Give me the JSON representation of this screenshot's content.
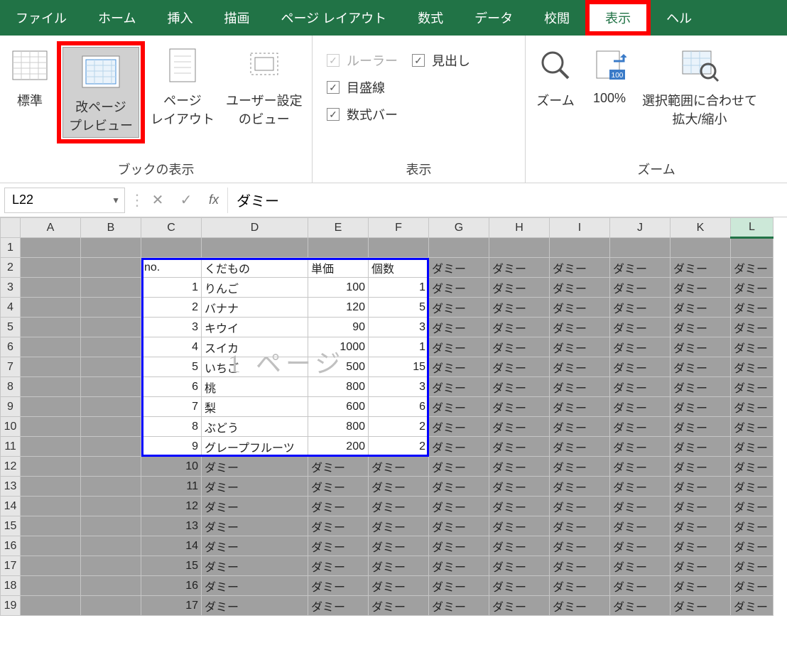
{
  "menu": {
    "tabs": [
      "ファイル",
      "ホーム",
      "挿入",
      "描画",
      "ページ レイアウト",
      "数式",
      "データ",
      "校閲",
      "表示",
      "ヘル"
    ],
    "active": "表示"
  },
  "ribbon": {
    "group_views": {
      "label": "ブックの表示",
      "normal": "標準",
      "page_break": "改ページ\nプレビュー",
      "page_layout": "ページ\nレイアウト",
      "custom": "ユーザー設定\nのビュー"
    },
    "group_show": {
      "label": "表示",
      "ruler": "ルーラー",
      "headings": "見出し",
      "gridlines": "目盛線",
      "formula_bar": "数式バー"
    },
    "group_zoom": {
      "label": "ズーム",
      "zoom": "ズーム",
      "hundred": "100%",
      "fit": "選択範囲に合わせて\n拡大/縮小"
    }
  },
  "formula_bar": {
    "name_box": "L22",
    "fx": "fx",
    "formula": "ダミー"
  },
  "grid": {
    "columns": [
      "A",
      "B",
      "C",
      "D",
      "E",
      "F",
      "G",
      "H",
      "I",
      "J",
      "K",
      "L"
    ],
    "active_col": "L",
    "rows": [
      1,
      2,
      3,
      4,
      5,
      6,
      7,
      8,
      9,
      10,
      11,
      12,
      13,
      14,
      15,
      16,
      17,
      18,
      19
    ],
    "header": {
      "no": "no.",
      "name": "くだもの",
      "price": "単価",
      "qty": "個数"
    },
    "fruits": [
      {
        "no": 1,
        "name": "りんご",
        "price": 100,
        "qty": 1
      },
      {
        "no": 2,
        "name": "バナナ",
        "price": 120,
        "qty": 5
      },
      {
        "no": 3,
        "name": "キウイ",
        "price": 90,
        "qty": 3
      },
      {
        "no": 4,
        "name": "スイカ",
        "price": 1000,
        "qty": 1
      },
      {
        "no": 5,
        "name": "いちご",
        "price": 500,
        "qty": 15
      },
      {
        "no": 6,
        "name": "桃",
        "price": 800,
        "qty": 3
      },
      {
        "no": 7,
        "name": "梨",
        "price": 600,
        "qty": 6
      },
      {
        "no": 8,
        "name": "ぶどう",
        "price": 800,
        "qty": 2
      },
      {
        "no": 9,
        "name": "グレープフルーツ",
        "price": 200,
        "qty": 2
      }
    ],
    "dummy": "ダミー",
    "extra_nos": [
      10,
      11,
      12,
      13,
      14,
      15,
      16,
      17
    ],
    "watermark": "1 ページ"
  }
}
